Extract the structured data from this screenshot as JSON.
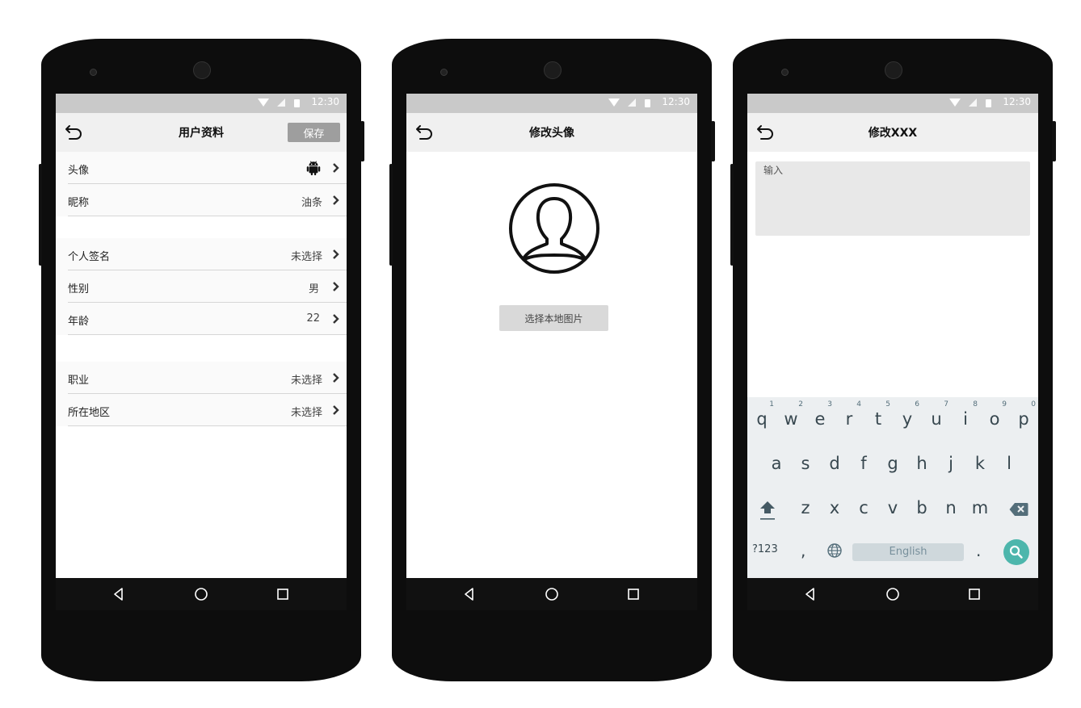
{
  "status_time": "12:30",
  "screens": [
    {
      "title": "用户资料",
      "save_label": "保存",
      "rows": [
        {
          "label": "头像",
          "value": "",
          "icon": "android-icon"
        },
        {
          "label": "昵称",
          "value": "油条"
        },
        {
          "label": "个人签名",
          "value": "未选择"
        },
        {
          "label": "性别",
          "value": "男"
        },
        {
          "label": "年龄",
          "value": "22"
        },
        {
          "label": "职业",
          "value": "未选择"
        },
        {
          "label": "所在地区",
          "value": "未选择"
        }
      ]
    },
    {
      "title": "修改头像",
      "choose_button": "选择本地图片"
    },
    {
      "title": "修改XXX",
      "input_placeholder": "输入",
      "keyboard": {
        "row1": [
          "q",
          "w",
          "e",
          "r",
          "t",
          "y",
          "u",
          "i",
          "o",
          "p"
        ],
        "row1_hints": [
          "1",
          "2",
          "3",
          "4",
          "5",
          "6",
          "7",
          "8",
          "9",
          "0"
        ],
        "row2": [
          "a",
          "s",
          "d",
          "f",
          "g",
          "h",
          "j",
          "k",
          "l"
        ],
        "row3": [
          "z",
          "x",
          "c",
          "v",
          "b",
          "n",
          "m"
        ],
        "sym_label": "?123",
        "comma": ",",
        "space_label": "English",
        "period": "."
      }
    }
  ],
  "colors": {
    "statusbar": "#c9c9c9",
    "appbar": "#f0f0f0",
    "save_button": "#9e9e9e",
    "keyboard_bg": "#eceff1",
    "search_key": "#4db6ac"
  }
}
